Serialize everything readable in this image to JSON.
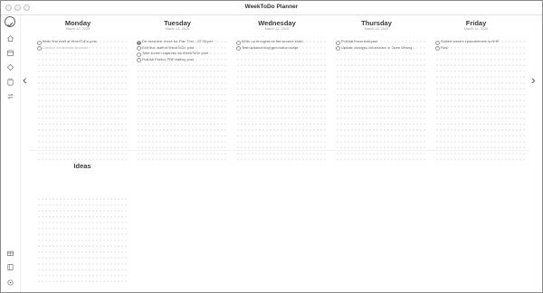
{
  "window": {
    "title": "WeekToDo Planner"
  },
  "sidebar": {
    "logo_icon": "weektodo-logo-icon",
    "top_icons": [
      "home-icon",
      "calendar-icon",
      "tag-icon",
      "clipboard-icon",
      "history-icon"
    ],
    "bottom_icons": [
      "gift-icon",
      "book-icon",
      "settings-icon"
    ]
  },
  "nav": {
    "prev": "‹",
    "next": "›"
  },
  "days": [
    {
      "name": "Monday",
      "date": "March 10, 2025",
      "tasks": [
        {
          "text": "Write first draft of WeekToDo post",
          "state": "open"
        },
        {
          "text": "Confirm conference abstract",
          "state": "done"
        }
      ]
    },
    {
      "name": "Tuesday",
      "date": "March 11, 2025",
      "tasks": [
        {
          "text": "Do dead link check for Flan Text... 07:30 pm",
          "state": "current"
        },
        {
          "text": "Edit first draft of WeekToDo post",
          "state": "open"
        },
        {
          "text": "Take screen captures for WeekToDo post",
          "state": "open"
        },
        {
          "text": "Publish Firefox PDF editing post",
          "state": "open"
        }
      ]
    },
    {
      "name": "Wednesday",
      "date": "March 12, 2025",
      "tasks": [
        {
          "text": "Write up thoughts on the second brain",
          "state": "open"
        },
        {
          "text": "Test updated blog generation script",
          "state": "open"
        }
      ]
    },
    {
      "name": "Thursday",
      "date": "March 13, 2025",
      "tasks": [
        {
          "text": "Publish Itmux test post",
          "state": "open"
        },
        {
          "text": "Update changes information in Open Chang...",
          "state": "open"
        }
      ]
    },
    {
      "name": "Friday",
      "date": "March 14, 2025",
      "tasks": [
        {
          "text": "Submit week's spreadsheets to NHK",
          "state": "open"
        },
        {
          "text": "Rest",
          "state": "open"
        }
      ]
    }
  ],
  "ideas": {
    "title": "Ideas"
  },
  "colors": {
    "accent": "#555555",
    "grid_dot": "#d6d6d6",
    "muted": "#b5b5b5"
  }
}
